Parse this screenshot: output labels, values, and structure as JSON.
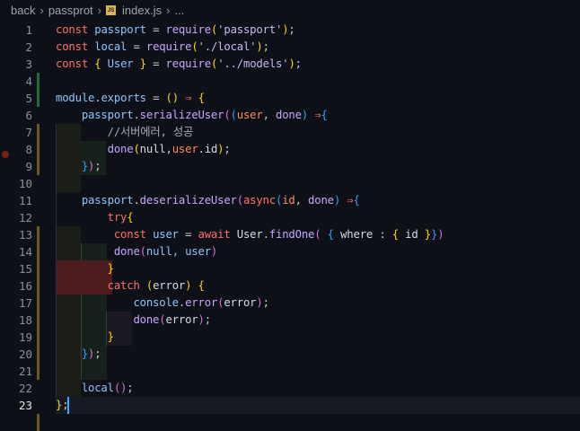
{
  "breadcrumb": {
    "items": [
      "back",
      "passprot",
      "index.js",
      "..."
    ],
    "file_icon": "JS"
  },
  "colors": {
    "background": "#0d1017",
    "keyword": "#ff6f6a",
    "identifier": "#8fc4ff",
    "string": "#c9b8f5",
    "bracket": "#ffd700",
    "cursor": "#3fa9ff"
  },
  "editor": {
    "current_line": 23,
    "breakpoint_line": 7,
    "lines": [
      [
        [
          "const ",
          "kw"
        ],
        [
          "passport ",
          "id"
        ],
        [
          "= ",
          "op"
        ],
        [
          "require",
          "fn"
        ],
        [
          "(",
          "b1"
        ],
        [
          "'passport'",
          "str"
        ],
        [
          ")",
          "b1"
        ],
        [
          ";",
          "op"
        ]
      ],
      [
        [
          "const ",
          "kw"
        ],
        [
          "local ",
          "id"
        ],
        [
          "= ",
          "op"
        ],
        [
          "require",
          "fn"
        ],
        [
          "(",
          "b1"
        ],
        [
          "'./local'",
          "str"
        ],
        [
          ")",
          "b1"
        ],
        [
          ";",
          "op"
        ]
      ],
      [
        [
          "const ",
          "kw"
        ],
        [
          "{",
          "b1"
        ],
        [
          " User ",
          "id"
        ],
        [
          "}",
          "b1"
        ],
        [
          " = ",
          "op"
        ],
        [
          "require",
          "fn"
        ],
        [
          "(",
          "b1"
        ],
        [
          "'../models'",
          "str"
        ],
        [
          ")",
          "b1"
        ],
        [
          ";",
          "op"
        ]
      ],
      [],
      [
        [
          "module",
          "id"
        ],
        [
          ".",
          "op"
        ],
        [
          "exports ",
          "id"
        ],
        [
          "= ",
          "op"
        ],
        [
          "()",
          "b1"
        ],
        [
          " ⇒ ",
          "kw"
        ],
        [
          "{",
          "b1"
        ]
      ],
      [
        [
          "    passport",
          "id"
        ],
        [
          ".",
          "op"
        ],
        [
          "serializeUser",
          "fn"
        ],
        [
          "(",
          "b2"
        ],
        [
          "(",
          "b3"
        ],
        [
          "user",
          "pa"
        ],
        [
          ", ",
          "op"
        ],
        [
          "done",
          "fn"
        ],
        [
          ")",
          "b3"
        ],
        [
          " ⇒",
          "kw"
        ],
        [
          "{",
          "b3"
        ]
      ],
      [
        [
          "        //서버에러, 성공",
          "cm"
        ]
      ],
      [
        [
          "        done",
          "fn"
        ],
        [
          "(",
          "b1"
        ],
        [
          "null",
          "pl"
        ],
        [
          ",",
          "op"
        ],
        [
          "user",
          "pa"
        ],
        [
          ".id",
          "pl"
        ],
        [
          ")",
          "b1"
        ],
        [
          ";",
          "op"
        ]
      ],
      [
        [
          "    ",
          "op"
        ],
        [
          "}",
          "b3"
        ],
        [
          ")",
          "b2"
        ],
        [
          ";",
          "op"
        ]
      ],
      [],
      [
        [
          "    passport",
          "id"
        ],
        [
          ".",
          "op"
        ],
        [
          "deserializeUser",
          "fn"
        ],
        [
          "(",
          "b2"
        ],
        [
          "async",
          "kw"
        ],
        [
          "(",
          "b3"
        ],
        [
          "id",
          "pa"
        ],
        [
          ", ",
          "op"
        ],
        [
          "done",
          "fn"
        ],
        [
          ")",
          "b3"
        ],
        [
          " ⇒",
          "kw"
        ],
        [
          "{",
          "b3"
        ]
      ],
      [
        [
          "        try",
          "kw"
        ],
        [
          "{",
          "b1"
        ]
      ],
      [
        [
          "         const ",
          "kw"
        ],
        [
          "user ",
          "id"
        ],
        [
          "= ",
          "op"
        ],
        [
          "await ",
          "kw"
        ],
        [
          "User",
          "pl"
        ],
        [
          ".",
          "op"
        ],
        [
          "findOne",
          "fn"
        ],
        [
          "(",
          "b2"
        ],
        [
          " { ",
          "b3"
        ],
        [
          "where ",
          "pl"
        ],
        [
          ": ",
          "op"
        ],
        [
          "{",
          "b1"
        ],
        [
          " id ",
          "pl"
        ],
        [
          "}",
          "b1"
        ],
        [
          "}",
          "b3"
        ],
        [
          ")",
          "b2"
        ]
      ],
      [
        [
          "         done",
          "fn"
        ],
        [
          "(",
          "b2"
        ],
        [
          "null, user",
          "id"
        ],
        [
          ")",
          "b2"
        ]
      ],
      [
        [
          "        }",
          "b1"
        ]
      ],
      [
        [
          "        catch ",
          "kw"
        ],
        [
          "(",
          "b1"
        ],
        [
          "error",
          "pl"
        ],
        [
          ")",
          "b1"
        ],
        [
          " {",
          "b1"
        ]
      ],
      [
        [
          "            console",
          "id"
        ],
        [
          ".",
          "op"
        ],
        [
          "error",
          "fn"
        ],
        [
          "(",
          "b2"
        ],
        [
          "error",
          "pl"
        ],
        [
          ")",
          "b2"
        ],
        [
          ";",
          "op"
        ]
      ],
      [
        [
          "            done",
          "fn"
        ],
        [
          "(",
          "b2"
        ],
        [
          "error",
          "pl"
        ],
        [
          ")",
          "b2"
        ],
        [
          ";",
          "op"
        ]
      ],
      [
        [
          "        }",
          "b1"
        ]
      ],
      [
        [
          "    ",
          "op"
        ],
        [
          "}",
          "b3"
        ],
        [
          ")",
          "b2"
        ],
        [
          ";",
          "op"
        ]
      ],
      [],
      [
        [
          "    local",
          "id"
        ],
        [
          "()",
          "b2"
        ],
        [
          ";",
          "op"
        ]
      ],
      [
        [
          "}",
          "b1"
        ],
        [
          ";",
          "op"
        ]
      ]
    ]
  }
}
